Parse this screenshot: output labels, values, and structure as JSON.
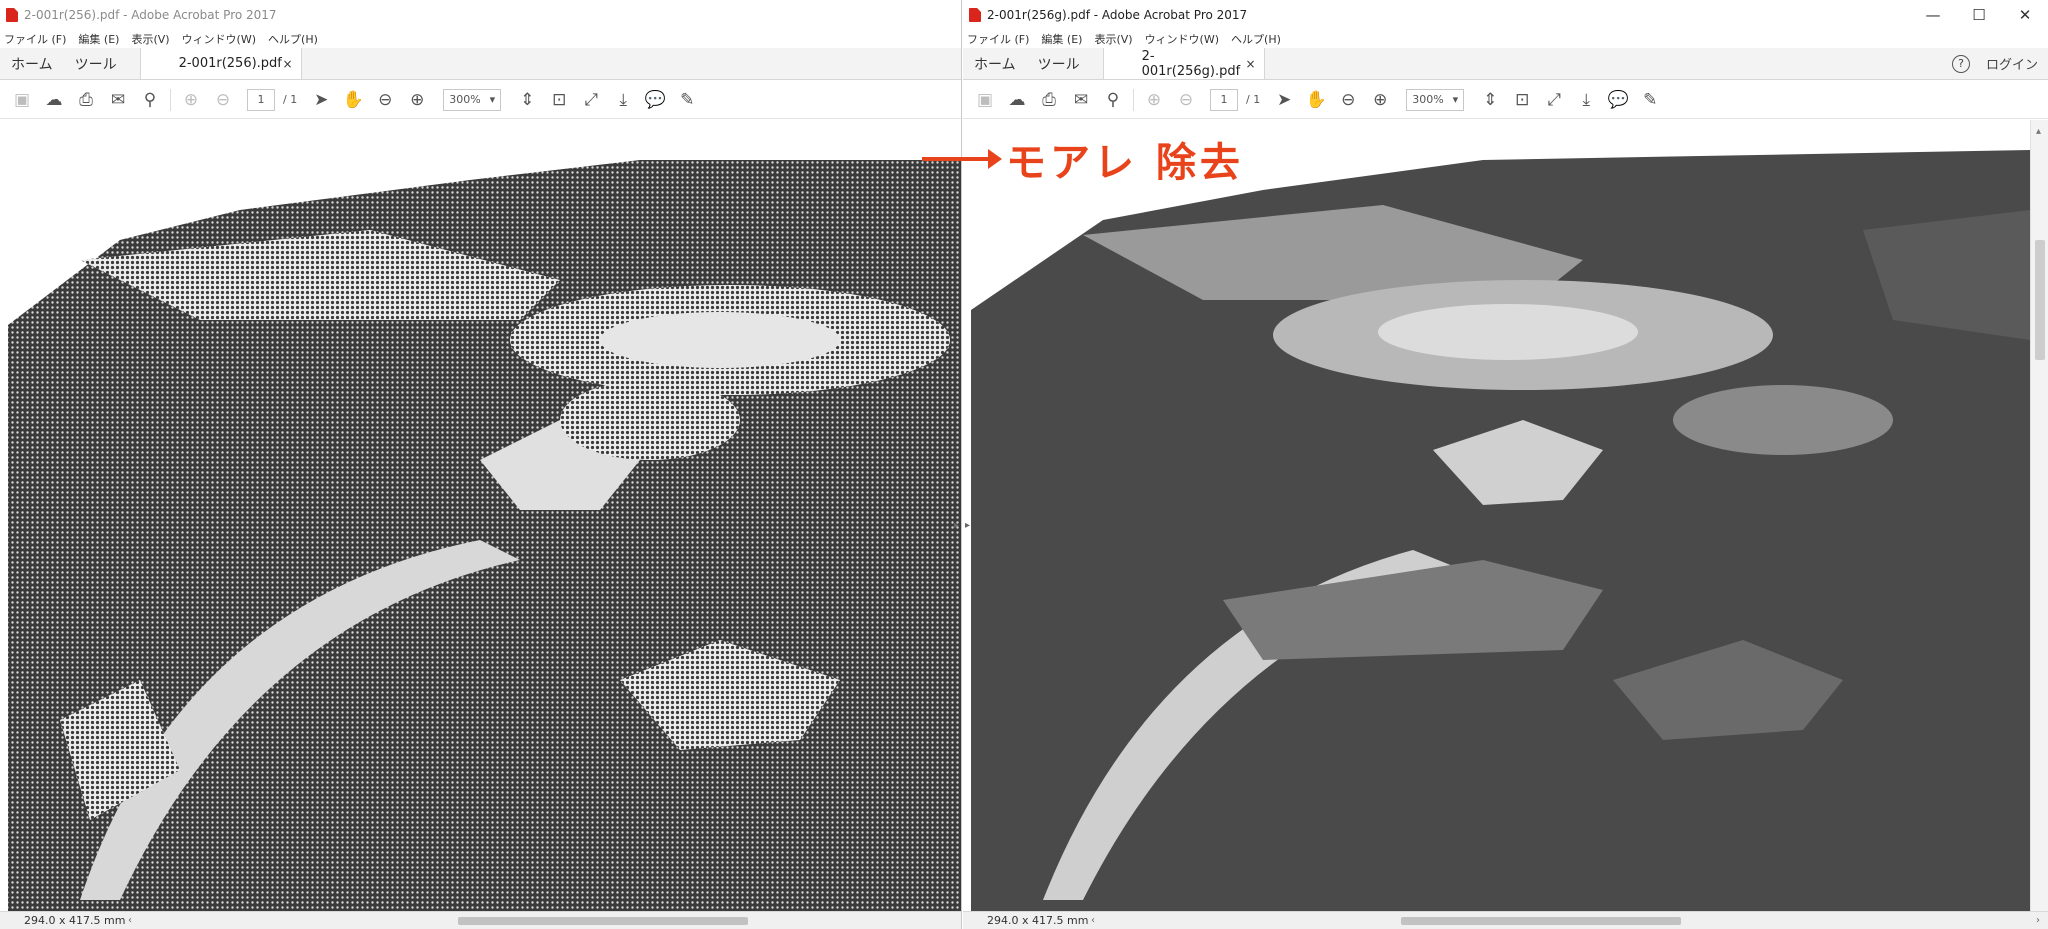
{
  "left": {
    "title": "2-001r(256).pdf - Adobe Acrobat Pro 2017",
    "menu": [
      "ファイル (F)",
      "編集 (E)",
      "表示(V)",
      "ウィンドウ(W)",
      "ヘルプ(H)"
    ],
    "nav_home": "ホーム",
    "nav_tools": "ツール",
    "tab_label": "2-001r(256).pdf",
    "tab_close": "×",
    "page_current": "1",
    "page_total": "/ 1",
    "zoom": "300%",
    "page_size": "294.0 x 417.5 mm"
  },
  "right": {
    "title": "2-001r(256g).pdf - Adobe Acrobat Pro 2017",
    "menu": [
      "ファイル (F)",
      "編集 (E)",
      "表示(V)",
      "ウィンドウ(W)",
      "ヘルプ(H)"
    ],
    "nav_home": "ホーム",
    "nav_tools": "ツール",
    "tab_label": "2-001r(256g).pdf",
    "tab_close": "×",
    "help": "?",
    "login": "ログイン",
    "page_current": "1",
    "page_total": "/ 1",
    "zoom": "300%",
    "page_size": "294.0 x 417.5 mm",
    "window_controls": {
      "minimize": "—",
      "maximize": "☐",
      "close": "✕"
    }
  },
  "annotation": {
    "text": "モアレ 除去",
    "color": "#e8431a"
  },
  "icons": [
    "save-icon",
    "cloud-upload-icon",
    "print-icon",
    "mail-icon",
    "search-icon",
    "page-up-icon",
    "page-down-icon",
    "select-arrow-icon",
    "hand-tool-icon",
    "zoom-out-icon",
    "zoom-in-icon",
    "fit-page-icon",
    "fit-width-icon",
    "full-screen-icon",
    "scroll-mode-icon",
    "comment-icon",
    "sign-icon"
  ],
  "colors": {
    "accent": "#2b72d8",
    "pdf_red": "#d9251c"
  }
}
